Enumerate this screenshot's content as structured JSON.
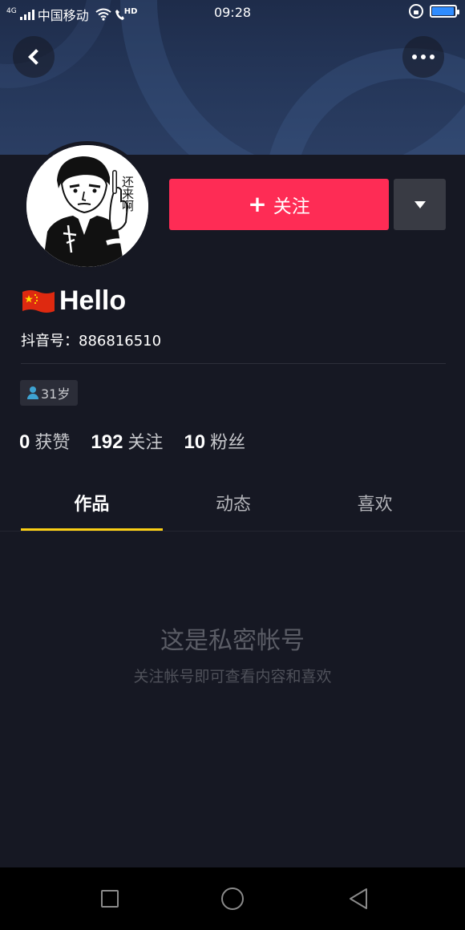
{
  "status_bar": {
    "network": "4G",
    "carrier": "中国移动",
    "hd_badge": "HD",
    "time": "09:28",
    "battery_level": 0.95
  },
  "header": {
    "back_icon": "chevron-left-icon",
    "more_icon": "more-dots-icon"
  },
  "profile": {
    "avatar_caption": "还来啊",
    "follow_label": "关注",
    "follow_plus": "+",
    "nickname": "Hello",
    "flag": "china-flag-icon",
    "douyin_id": "抖音号：886816510",
    "age_tag": "31岁"
  },
  "stats": [
    {
      "value": "0",
      "label": "获赞"
    },
    {
      "value": "192",
      "label": "关注"
    },
    {
      "value": "10",
      "label": "粉丝"
    }
  ],
  "tabs": [
    {
      "label": "作品",
      "active": true
    },
    {
      "label": "动态",
      "active": false
    },
    {
      "label": "喜欢",
      "active": false
    }
  ],
  "private_notice": {
    "title": "这是私密帐号",
    "subtitle": "关注帐号即可查看内容和喜欢"
  },
  "colors": {
    "background": "#161823",
    "follow_button": "#fe2c55",
    "tab_indicator": "#face15"
  }
}
